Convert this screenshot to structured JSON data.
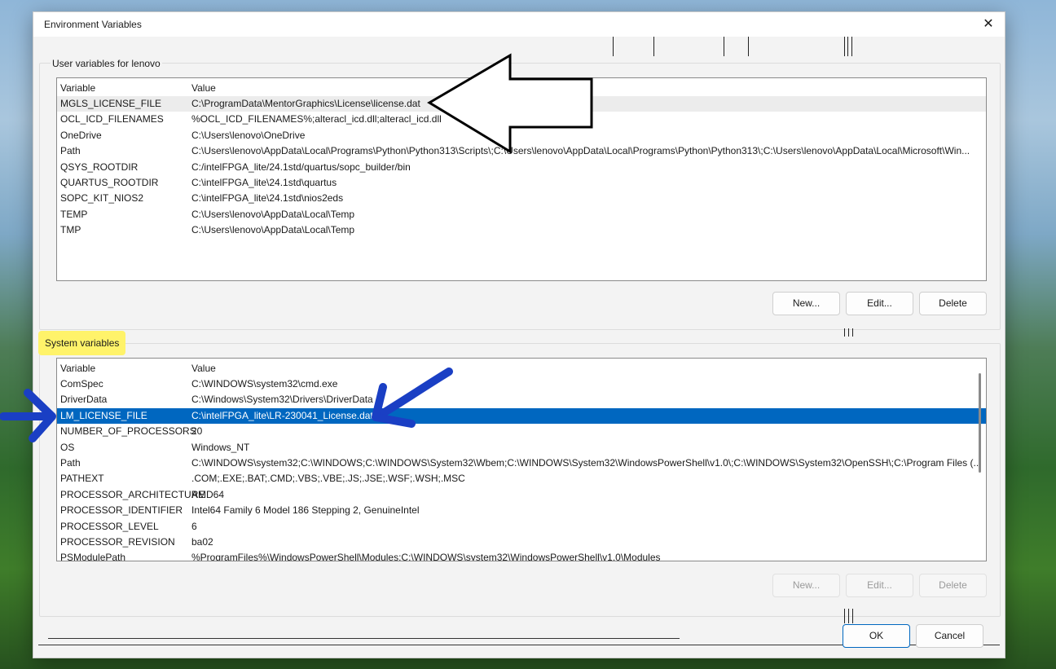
{
  "window": {
    "title": "Environment Variables",
    "close_icon": "close-icon",
    "close_glyph": "✕"
  },
  "user_vars": {
    "label": "User variables for lenovo",
    "columns": {
      "variable": "Variable",
      "value": "Value"
    },
    "rows": [
      {
        "name": "MGLS_LICENSE_FILE",
        "value": "C:\\ProgramData\\MentorGraphics\\License\\license.dat"
      },
      {
        "name": "OCL_ICD_FILENAMES",
        "value": "%OCL_ICD_FILENAMES%;alteracl_icd.dll;alteracl_icd.dll"
      },
      {
        "name": "OneDrive",
        "value": "C:\\Users\\lenovo\\OneDrive"
      },
      {
        "name": "Path",
        "value": "C:\\Users\\lenovo\\AppData\\Local\\Programs\\Python\\Python313\\Scripts\\;C:\\Users\\lenovo\\AppData\\Local\\Programs\\Python\\Python313\\;C:\\Users\\lenovo\\AppData\\Local\\Microsoft\\Win..."
      },
      {
        "name": "QSYS_ROOTDIR",
        "value": "C:/intelFPGA_lite/24.1std/quartus/sopc_builder/bin"
      },
      {
        "name": "QUARTUS_ROOTDIR",
        "value": "C:\\intelFPGA_lite\\24.1std\\quartus"
      },
      {
        "name": "SOPC_KIT_NIOS2",
        "value": "C:\\intelFPGA_lite\\24.1std\\nios2eds"
      },
      {
        "name": "TEMP",
        "value": "C:\\Users\\lenovo\\AppData\\Local\\Temp"
      },
      {
        "name": "TMP",
        "value": "C:\\Users\\lenovo\\AppData\\Local\\Temp"
      }
    ],
    "buttons": {
      "new": "New...",
      "edit": "Edit...",
      "delete": "Delete"
    }
  },
  "system_vars": {
    "label": "System variables",
    "highlight_color": "#fff36a",
    "columns": {
      "variable": "Variable",
      "value": "Value"
    },
    "rows": [
      {
        "name": "ComSpec",
        "value": "C:\\WINDOWS\\system32\\cmd.exe"
      },
      {
        "name": "DriverData",
        "value": "C:\\Windows\\System32\\Drivers\\DriverData"
      },
      {
        "name": "LM_LICENSE_FILE",
        "value": "C:\\intelFPGA_lite\\LR-230041_License.dat"
      },
      {
        "name": "NUMBER_OF_PROCESSORS",
        "value": "20"
      },
      {
        "name": "OS",
        "value": "Windows_NT"
      },
      {
        "name": "Path",
        "value": "C:\\WINDOWS\\system32;C:\\WINDOWS;C:\\WINDOWS\\System32\\Wbem;C:\\WINDOWS\\System32\\WindowsPowerShell\\v1.0\\;C:\\WINDOWS\\System32\\OpenSSH\\;C:\\Program Files (..."
      },
      {
        "name": "PATHEXT",
        "value": ".COM;.EXE;.BAT;.CMD;.VBS;.VBE;.JS;.JSE;.WSF;.WSH;.MSC"
      },
      {
        "name": "PROCESSOR_ARCHITECTURE",
        "value": "AMD64"
      },
      {
        "name": "PROCESSOR_IDENTIFIER",
        "value": "Intel64 Family 6 Model 186 Stepping 2, GenuineIntel"
      },
      {
        "name": "PROCESSOR_LEVEL",
        "value": "6"
      },
      {
        "name": "PROCESSOR_REVISION",
        "value": "ba02"
      },
      {
        "name": "PSModulePath",
        "value": "%ProgramFiles%\\WindowsPowerShell\\Modules;C:\\WINDOWS\\system32\\WindowsPowerShell\\v1.0\\Modules"
      }
    ],
    "selected_index": 2,
    "selection_color": "#0067c0",
    "buttons": {
      "new": "New...",
      "edit": "Edit...",
      "delete": "Delete"
    }
  },
  "footer": {
    "ok": "OK",
    "cancel": "Cancel"
  },
  "annotations": {
    "black_arrow": {
      "icon": "arrow-left-icon",
      "color": "#000000"
    },
    "blue_arrows": {
      "icon": "arrow-icon",
      "color": "#1a3fc4"
    }
  }
}
